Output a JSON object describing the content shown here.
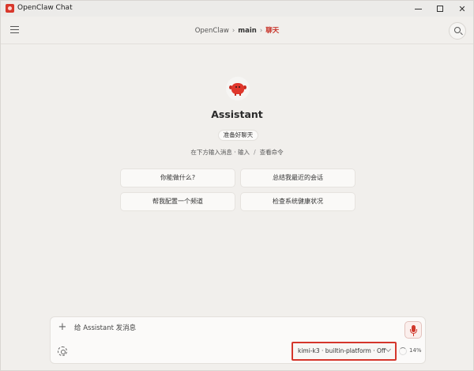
{
  "window": {
    "title": "OpenClaw Chat"
  },
  "breadcrumb": {
    "root": "OpenClaw",
    "section": "main",
    "current": "聊天"
  },
  "welcome": {
    "title": "Assistant",
    "badge": "准备好聊天",
    "hint_prefix": "在下方输入消息 · 输入",
    "hint_slash": "/",
    "hint_suffix": "查看命令"
  },
  "suggestions": [
    "你能做什么?",
    "总结我最近的会话",
    "帮我配置一个频道",
    "检查系统健康状况"
  ],
  "composer": {
    "placeholder": "给 Assistant 发消息",
    "model": "kimi-k3 · builtin-platform · Off",
    "context_usage": "14%"
  },
  "icons": {
    "menu": "hamburger-menu-icon",
    "search": "search-icon",
    "plus": "plus-icon",
    "mic": "microphone-icon",
    "settings": "gear-icon",
    "dropdown": "chevron-down-icon"
  },
  "colors": {
    "accent": "#d5362c",
    "background": "#f1efec"
  }
}
